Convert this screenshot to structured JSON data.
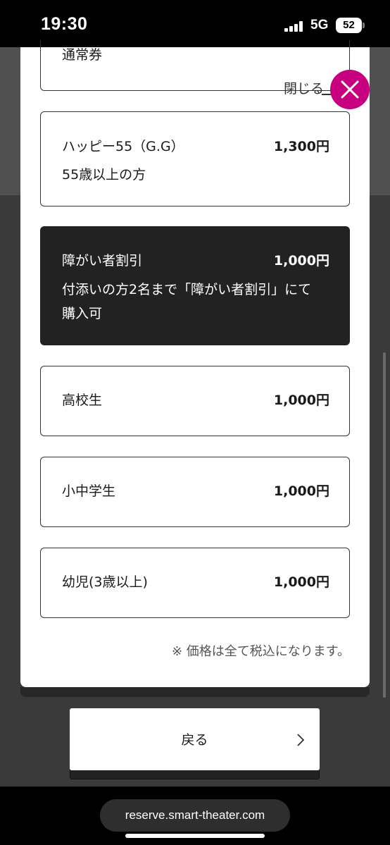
{
  "status_bar": {
    "time": "19:30",
    "network": "5G",
    "battery": "52",
    "signal_icon": "signal-bars-icon"
  },
  "modal": {
    "partial_item": {
      "name": "通常券"
    },
    "close_label": "閉じる",
    "close_icon": "close-icon",
    "tickets": [
      {
        "name": "ハッピー55（G.G）",
        "price": "1,300円",
        "note": "55歳以上の方",
        "selected": false
      },
      {
        "name": "障がい者割引",
        "price": "1,000円",
        "note_lines": [
          "付添いの方2名まで「障がい者割引」にて",
          "購入可"
        ],
        "selected": true
      },
      {
        "name": "高校生",
        "price": "1,000円",
        "selected": false
      },
      {
        "name": "小中学生",
        "price": "1,000円",
        "selected": false
      },
      {
        "name": "幼児(3歳以上)",
        "price": "1,000円",
        "selected": false
      }
    ],
    "tax_note": "※ 価格は全て税込になります。"
  },
  "back_button": {
    "label": "戻る",
    "icon": "chevron-right-icon"
  },
  "browser": {
    "url": "reserve.smart-theater.com"
  },
  "colors": {
    "accent": "#c6007e",
    "selected_bg": "#222222"
  }
}
